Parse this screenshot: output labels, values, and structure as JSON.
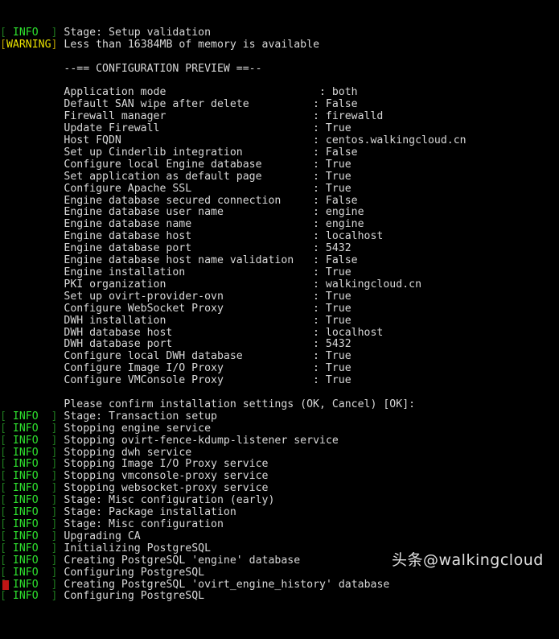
{
  "terminal": {
    "title": "oVirt engine-setup console",
    "colors": {
      "background": "#000000",
      "foreground": "#d8d8d8",
      "info": "#2ee02e",
      "info_bracket": "#1f7a1f",
      "warning": "#e8e000",
      "warning_bracket": "#b9a100",
      "cursor": "#c01515"
    },
    "cursor": {
      "glyph": "block-cursor",
      "visible": true
    },
    "lines": [
      {
        "tag": "[ INFO  ]",
        "level": "info",
        "text": "Stage: Setup validation"
      },
      {
        "tag": "[WARNING]",
        "level": "warning",
        "text": "Less than 16384MB of memory is available"
      },
      {
        "tag": "",
        "level": "plain",
        "text": ""
      },
      {
        "tag": "",
        "level": "plain",
        "text": "          --== CONFIGURATION PREVIEW ==--"
      },
      {
        "tag": "",
        "level": "plain",
        "text": ""
      },
      {
        "tag": "",
        "level": "plain",
        "text": "          Application mode                        : both"
      },
      {
        "tag": "",
        "level": "plain",
        "text": "          Default SAN wipe after delete          : False"
      },
      {
        "tag": "",
        "level": "plain",
        "text": "          Firewall manager                       : firewalld"
      },
      {
        "tag": "",
        "level": "plain",
        "text": "          Update Firewall                        : True"
      },
      {
        "tag": "",
        "level": "plain",
        "text": "          Host FQDN                              : centos.walkingcloud.cn"
      },
      {
        "tag": "",
        "level": "plain",
        "text": "          Set up Cinderlib integration           : False"
      },
      {
        "tag": "",
        "level": "plain",
        "text": "          Configure local Engine database        : True"
      },
      {
        "tag": "",
        "level": "plain",
        "text": "          Set application as default page        : True"
      },
      {
        "tag": "",
        "level": "plain",
        "text": "          Configure Apache SSL                   : True"
      },
      {
        "tag": "",
        "level": "plain",
        "text": "          Engine database secured connection     : False"
      },
      {
        "tag": "",
        "level": "plain",
        "text": "          Engine database user name              : engine"
      },
      {
        "tag": "",
        "level": "plain",
        "text": "          Engine database name                   : engine"
      },
      {
        "tag": "",
        "level": "plain",
        "text": "          Engine database host                   : localhost"
      },
      {
        "tag": "",
        "level": "plain",
        "text": "          Engine database port                   : 5432"
      },
      {
        "tag": "",
        "level": "plain",
        "text": "          Engine database host name validation   : False"
      },
      {
        "tag": "",
        "level": "plain",
        "text": "          Engine installation                    : True"
      },
      {
        "tag": "",
        "level": "plain",
        "text": "          PKI organization                       : walkingcloud.cn"
      },
      {
        "tag": "",
        "level": "plain",
        "text": "          Set up ovirt-provider-ovn              : True"
      },
      {
        "tag": "",
        "level": "plain",
        "text": "          Configure WebSocket Proxy              : True"
      },
      {
        "tag": "",
        "level": "plain",
        "text": "          DWH installation                       : True"
      },
      {
        "tag": "",
        "level": "plain",
        "text": "          DWH database host                      : localhost"
      },
      {
        "tag": "",
        "level": "plain",
        "text": "          DWH database port                      : 5432"
      },
      {
        "tag": "",
        "level": "plain",
        "text": "          Configure local DWH database           : True"
      },
      {
        "tag": "",
        "level": "plain",
        "text": "          Configure Image I/O Proxy              : True"
      },
      {
        "tag": "",
        "level": "plain",
        "text": "          Configure VMConsole Proxy              : True"
      },
      {
        "tag": "",
        "level": "plain",
        "text": ""
      },
      {
        "tag": "",
        "level": "plain",
        "text": "          Please confirm installation settings (OK, Cancel) [OK]:"
      },
      {
        "tag": "[ INFO  ]",
        "level": "info",
        "text": "Stage: Transaction setup"
      },
      {
        "tag": "[ INFO  ]",
        "level": "info",
        "text": "Stopping engine service"
      },
      {
        "tag": "[ INFO  ]",
        "level": "info",
        "text": "Stopping ovirt-fence-kdump-listener service"
      },
      {
        "tag": "[ INFO  ]",
        "level": "info",
        "text": "Stopping dwh service"
      },
      {
        "tag": "[ INFO  ]",
        "level": "info",
        "text": "Stopping Image I/O Proxy service"
      },
      {
        "tag": "[ INFO  ]",
        "level": "info",
        "text": "Stopping vmconsole-proxy service"
      },
      {
        "tag": "[ INFO  ]",
        "level": "info",
        "text": "Stopping websocket-proxy service"
      },
      {
        "tag": "[ INFO  ]",
        "level": "info",
        "text": "Stage: Misc configuration (early)"
      },
      {
        "tag": "[ INFO  ]",
        "level": "info",
        "text": "Stage: Package installation"
      },
      {
        "tag": "[ INFO  ]",
        "level": "info",
        "text": "Stage: Misc configuration"
      },
      {
        "tag": "[ INFO  ]",
        "level": "info",
        "text": "Upgrading CA"
      },
      {
        "tag": "[ INFO  ]",
        "level": "info",
        "text": "Initializing PostgreSQL"
      },
      {
        "tag": "[ INFO  ]",
        "level": "info",
        "text": "Creating PostgreSQL 'engine' database"
      },
      {
        "tag": "[ INFO  ]",
        "level": "info",
        "text": "Configuring PostgreSQL"
      },
      {
        "tag": "[ INFO  ]",
        "level": "info",
        "text": "Creating PostgreSQL 'ovirt_engine_history' database"
      },
      {
        "tag": "[ INFO  ]",
        "level": "info",
        "text": "Configuring PostgreSQL"
      }
    ]
  },
  "watermark": {
    "text": "头条@walkingcloud"
  }
}
